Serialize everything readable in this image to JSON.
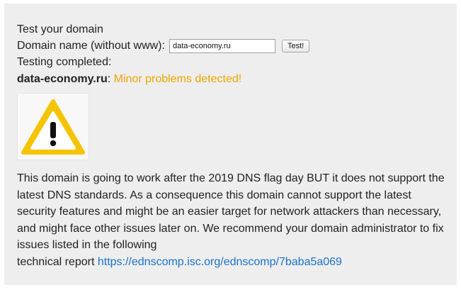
{
  "heading": "Test your domain",
  "form": {
    "label": "Domain name (without www):",
    "input_value": "data-economy.ru",
    "button_label": "Test!"
  },
  "status_line": "Testing completed:",
  "result": {
    "domain": "data-economy.ru",
    "separator": ":",
    "status": "Minor problems detected!",
    "status_color": "#f0a400"
  },
  "icon": {
    "name": "warning-triangle-icon",
    "fill": "#f5c400"
  },
  "description": "This domain is going to work after the 2019 DNS flag day BUT it does not support the latest DNS standards. As a consequence this domain cannot support the latest security features and might be an easier target for network attackers than necessary, and might face other issues later on. We recommend your domain administrator to fix issues listed in the following",
  "report": {
    "prefix": "technical report",
    "link_text": "https://ednscomp.isc.org/ednscomp/7baba5a069"
  }
}
